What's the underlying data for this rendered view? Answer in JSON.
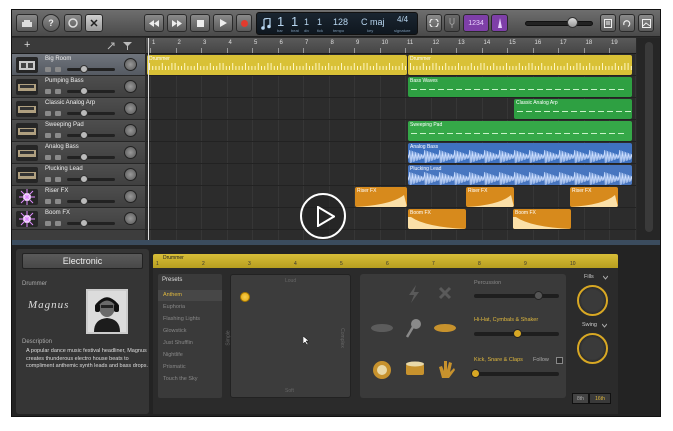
{
  "lcd": {
    "bar": "1",
    "beat": "1",
    "div": "1",
    "tick": "1",
    "tempo": "128",
    "key": "C maj",
    "sig": "4/4",
    "sub_bar": "bar",
    "sub_beat": "beat",
    "sub_div": "div",
    "sub_tick": "tick",
    "sub_tempo": "tempo",
    "sub_key": "key",
    "sub_sig": "signature"
  },
  "count_in": "1234",
  "ruler_marks": [
    "1",
    "2",
    "3",
    "4",
    "5",
    "6",
    "7",
    "8",
    "9",
    "10",
    "11",
    "12",
    "13",
    "14",
    "15",
    "16",
    "17",
    "18",
    "19"
  ],
  "tracks": [
    {
      "name": "Big Room",
      "icon": "drummer-icon"
    },
    {
      "name": "Pumping Bass",
      "icon": "synth-icon"
    },
    {
      "name": "Classic Analog Arp",
      "icon": "synth-icon"
    },
    {
      "name": "Sweeping Pad",
      "icon": "synth-icon"
    },
    {
      "name": "Analog Bass",
      "icon": "synth-icon"
    },
    {
      "name": "Plucking Lead",
      "icon": "synth-icon"
    },
    {
      "name": "Riser FX",
      "icon": "fx-icon"
    },
    {
      "name": "Boom FX",
      "icon": "fx-icon"
    }
  ],
  "regions": {
    "drummer1": "Drummer",
    "drummer2": "Drummer",
    "bass_waves": "Bass Waves",
    "classic_analog_arp": "Classic Analog Arp",
    "sweeping_pad": "Sweeping Pad",
    "analog_bass": "Analog Bass",
    "plucking_lead": "Plucking Lead",
    "riser": "Riser FX",
    "boom": "Boom FX"
  },
  "editor": {
    "genre": "Electronic",
    "drummer_label": "Drummer",
    "drummer_name": "Magnus",
    "description_label": "Description",
    "description": "A popular dance music festival headliner, Magnus creates thunderous electro house beats to compliment anthemic synth leads and bass drops.",
    "region_name": "Drummer",
    "bar_ticks": [
      "1",
      "2",
      "3",
      "4",
      "5",
      "6",
      "7",
      "8",
      "9",
      "10"
    ],
    "presets_header": "Presets",
    "presets": [
      "Anthem",
      "Euphoria",
      "Flashing Lights",
      "Glowstick",
      "Just Shufflin",
      "Nightlife",
      "Prismatic",
      "Touch the Sky"
    ],
    "selected_preset": 0,
    "xy": {
      "top": "Loud",
      "bottom": "Soft",
      "left": "Simple",
      "right": "Complex"
    },
    "percussion": "Percussion",
    "hihat": "Hi-Hat, Cymbals & Shaker",
    "kick": "Kick, Snare & Claps",
    "follow": "Follow",
    "fills": "Fills",
    "swing": "Swing",
    "note_8th": "8th",
    "note_16th": "16th"
  },
  "colors": {
    "drummer": "#d9c136",
    "green": "#2ea042",
    "blue": "#3f72c0",
    "orange": "#d78a1c",
    "accent": "#e0b93e"
  }
}
